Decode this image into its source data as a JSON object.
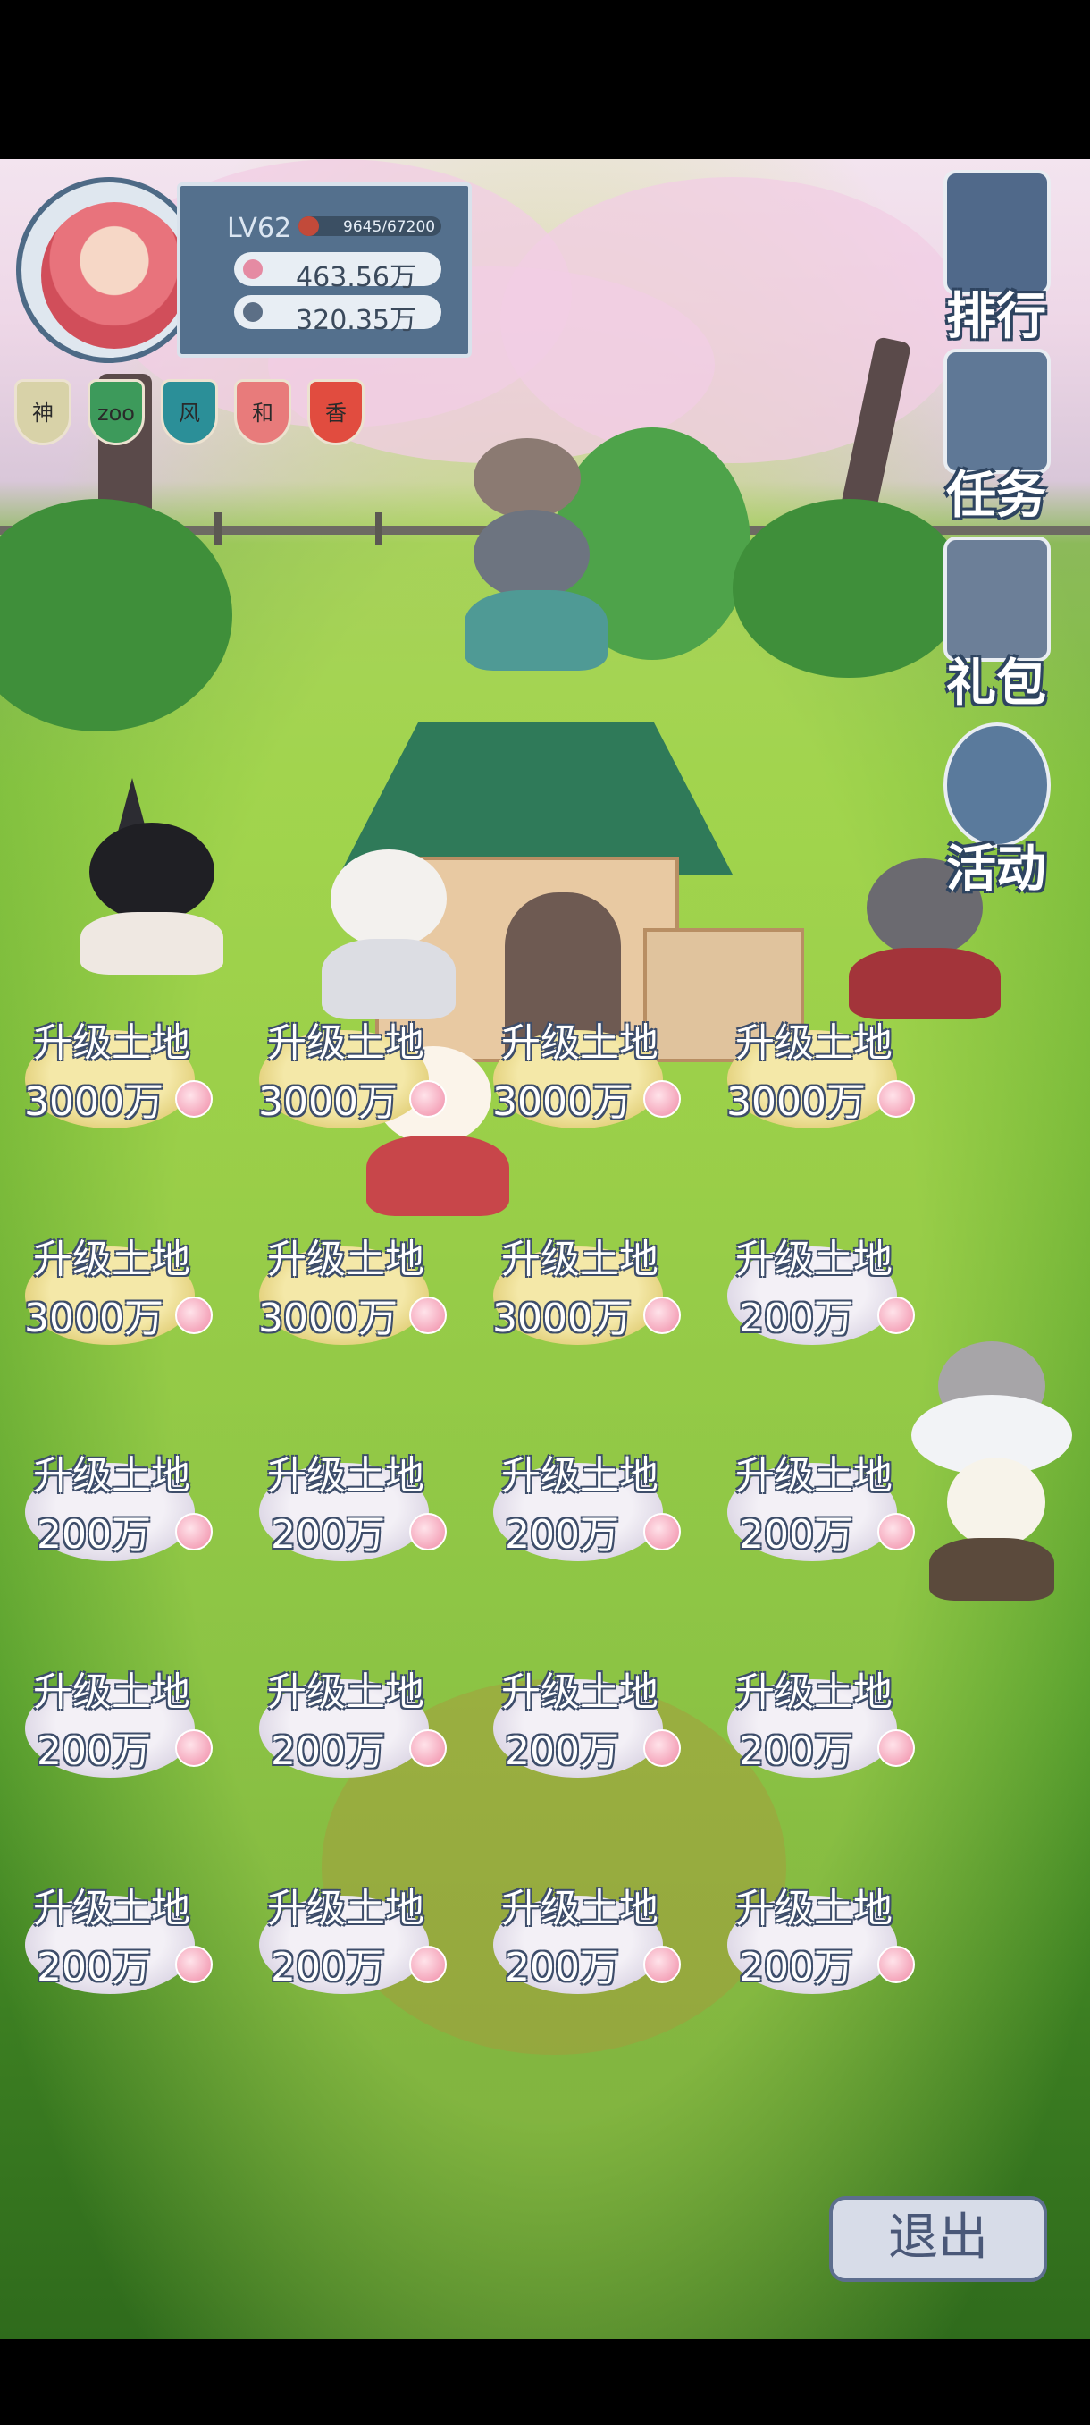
{
  "player": {
    "level_label": "LV62",
    "xp_text": "9645/67200",
    "xp_fraction": 0.1435,
    "resource1": "463.56万",
    "resource2": "320.35万"
  },
  "badges": [
    {
      "label": "神",
      "color": "#d8d2a8"
    },
    {
      "label": "zoo",
      "color": "#3d9a5b"
    },
    {
      "label": "风",
      "color": "#2b8f98"
    },
    {
      "label": "和",
      "color": "#e87b7b"
    },
    {
      "label": "香",
      "color": "#e14c3f"
    }
  ],
  "menu": {
    "rank": "排行",
    "tasks": "任务",
    "gift": "礼包",
    "event": "活动"
  },
  "plots": [
    {
      "label": "升级土地",
      "cost": "3000万",
      "tier": "gold"
    },
    {
      "label": "升级土地",
      "cost": "3000万",
      "tier": "gold"
    },
    {
      "label": "升级土地",
      "cost": "3000万",
      "tier": "gold"
    },
    {
      "label": "升级土地",
      "cost": "3000万",
      "tier": "gold"
    },
    {
      "label": "升级土地",
      "cost": "3000万",
      "tier": "gold"
    },
    {
      "label": "升级土地",
      "cost": "3000万",
      "tier": "gold"
    },
    {
      "label": "升级土地",
      "cost": "3000万",
      "tier": "gold"
    },
    {
      "label": "升级土地",
      "cost": "200万",
      "tier": "silver"
    },
    {
      "label": "升级土地",
      "cost": "200万",
      "tier": "silver"
    },
    {
      "label": "升级土地",
      "cost": "200万",
      "tier": "silver"
    },
    {
      "label": "升级土地",
      "cost": "200万",
      "tier": "silver"
    },
    {
      "label": "升级土地",
      "cost": "200万",
      "tier": "silver"
    },
    {
      "label": "升级土地",
      "cost": "200万",
      "tier": "silver"
    },
    {
      "label": "升级土地",
      "cost": "200万",
      "tier": "silver"
    },
    {
      "label": "升级土地",
      "cost": "200万",
      "tier": "silver"
    },
    {
      "label": "升级土地",
      "cost": "200万",
      "tier": "silver"
    },
    {
      "label": "升级土地",
      "cost": "200万",
      "tier": "silver"
    },
    {
      "label": "升级土地",
      "cost": "200万",
      "tier": "silver"
    },
    {
      "label": "升级土地",
      "cost": "200万",
      "tier": "silver"
    },
    {
      "label": "升级土地",
      "cost": "200万",
      "tier": "silver"
    }
  ],
  "exit_label": "退出"
}
